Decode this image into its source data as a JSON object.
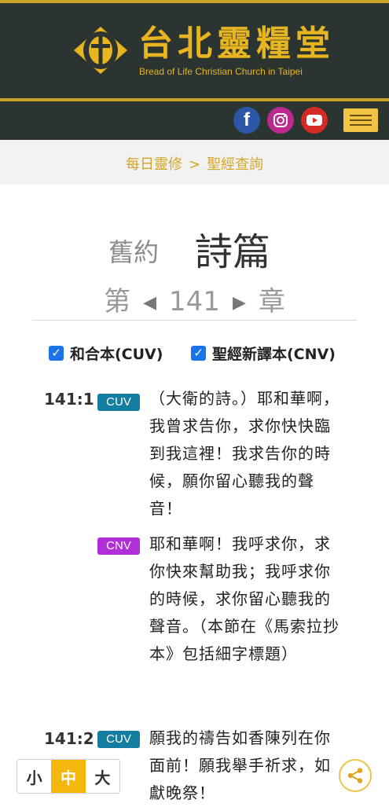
{
  "brand": {
    "title": "台北靈糧堂",
    "subtitle": "Bread of Life Christian Church in Taipei"
  },
  "social": [
    {
      "name": "facebook",
      "icon": "facebook-icon",
      "glyph": "f"
    },
    {
      "name": "instagram",
      "icon": "instagram-icon"
    },
    {
      "name": "youtube",
      "icon": "youtube-icon"
    }
  ],
  "breadcrumb": {
    "items": [
      "每日靈修",
      "聖經查詢"
    ],
    "separator": ">"
  },
  "book": {
    "testament": "舊約",
    "name": "詩篇",
    "chapter_prefix": "第",
    "chapter": "141",
    "chapter_suffix": "章"
  },
  "versions": [
    {
      "label": "和合本(CUV)",
      "checked": true
    },
    {
      "label": "聖經新譯本(CNV)",
      "checked": true
    }
  ],
  "verses": [
    {
      "ref": "141:1",
      "cuv": "（大衛的詩。）耶和華啊，我曾求告你，求你快快臨到我這裡！我求告你的時候，願你留心聽我的聲音！",
      "cnv": "耶和華啊！我呼求你，求你快來幫助我；我呼求你的時候，求你留心聽我的聲音。（本節在《馬索拉抄本》包括細字標題）"
    },
    {
      "ref": "141:2",
      "cuv": "願我的禱告如香陳列在你面前！願我舉手祈求，如獻晚祭！"
    }
  ],
  "badges": {
    "cuv": "CUV",
    "cnv": "CNV"
  },
  "font_size": {
    "small": "小",
    "medium": "中",
    "large": "大",
    "selected": "中"
  },
  "colors": {
    "header_bg": "#2b3431",
    "gold": "#e6b520",
    "cuv_badge": "#147ea1",
    "cnv_badge": "#b02fd8",
    "active_size": "#f3b70e"
  }
}
